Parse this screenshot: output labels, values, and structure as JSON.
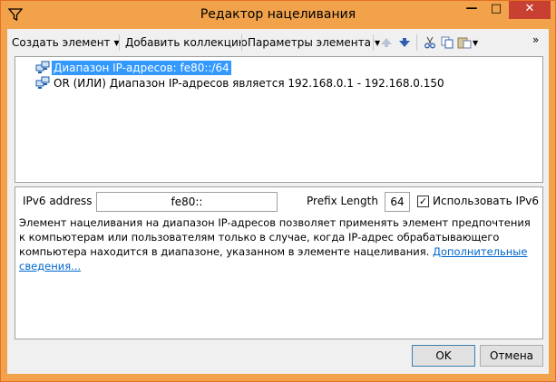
{
  "window": {
    "title": "Редактор нацеливания",
    "min_glyph": "—",
    "max_glyph": "□",
    "close_glyph": "✕"
  },
  "toolbar": {
    "create_item": "Создать элемент",
    "add_collection": "Добавить коллекцию",
    "item_options": "Параметры элемента",
    "overflow": "»"
  },
  "tree": {
    "items": [
      {
        "label": "Диапазон IP-адресов: fe80::/64",
        "selected": true
      },
      {
        "label": "OR (ИЛИ) Диапазон IP-адресов является 192.168.0.1 - 192.168.0.150",
        "selected": false
      }
    ]
  },
  "props": {
    "ipv6_label": "IPv6 address",
    "ipv6_value": "fe80::",
    "prefix_label": "Prefix Length",
    "prefix_value": "64",
    "use_ipv6_label": "Использовать IPv6",
    "use_ipv6_checked": true,
    "description": "Элемент нацеливания на диапазон IP-адресов позволяет применять элемент предпочтения к компьютерам или пользователям только в случае, когда IP-адрес обрабатывающего компьютера находится в диапазоне, указанном в элементе нацеливания.",
    "more_info": "Дополнительные сведения..."
  },
  "buttons": {
    "ok": "OK",
    "cancel": "Отмена"
  },
  "colors": {
    "titlebar": "#f2a24a",
    "close_button": "#c84031",
    "selection": "#3399ff",
    "link": "#0066cc"
  }
}
